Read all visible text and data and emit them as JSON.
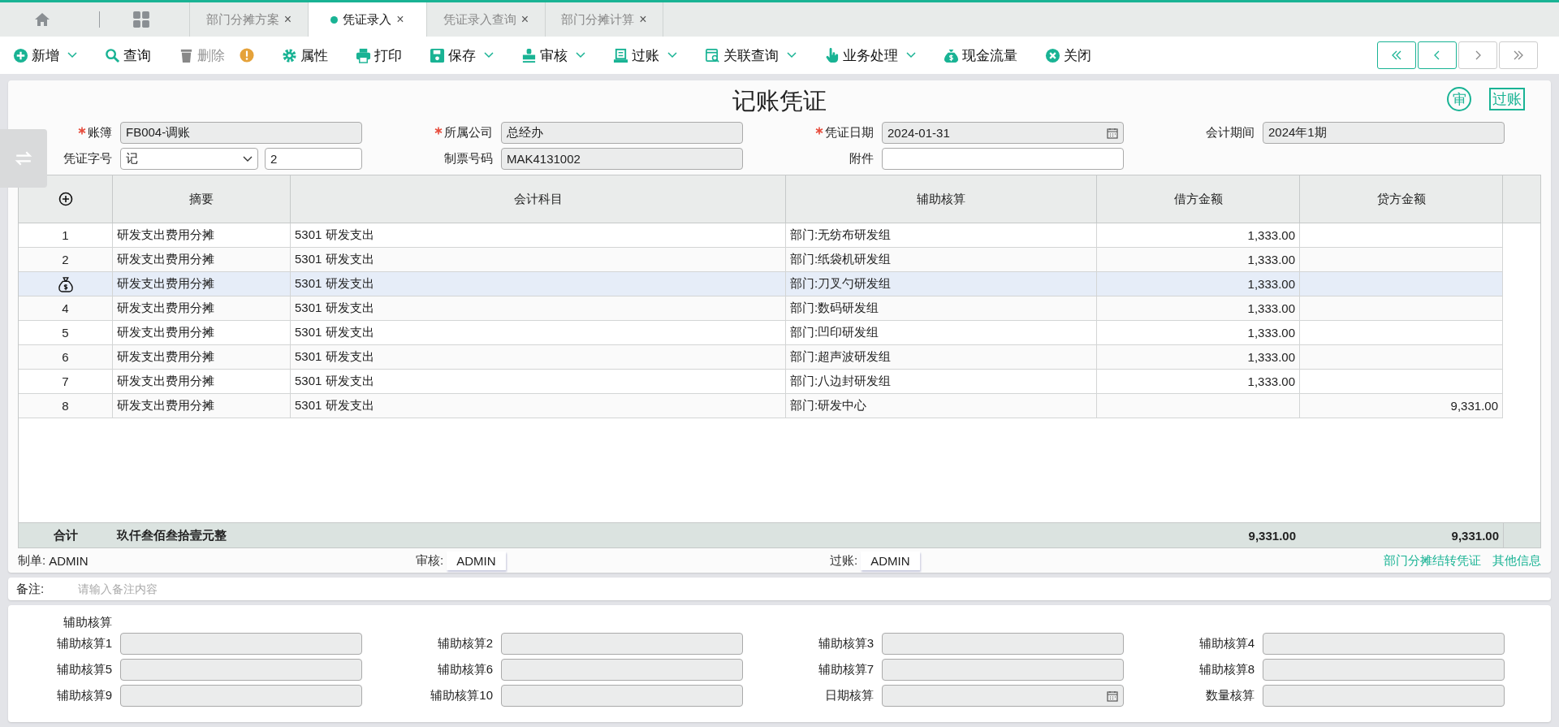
{
  "tabs": [
    {
      "label": "部门分摊方案",
      "selected": false,
      "close": "×"
    },
    {
      "label": "凭证录入",
      "selected": true,
      "close": "×"
    },
    {
      "label": "凭证录入查询",
      "selected": false,
      "close": "×"
    },
    {
      "label": "部门分摊计算",
      "selected": false,
      "close": "×"
    }
  ],
  "toolbar": [
    {
      "label": "新增",
      "kind": "add",
      "dropdown": true,
      "disabled": false
    },
    {
      "label": "查询",
      "kind": "search",
      "dropdown": false,
      "disabled": false
    },
    {
      "label": "删除",
      "kind": "delete",
      "dropdown": false,
      "disabled": true
    },
    {
      "label": "属性",
      "kind": "gear",
      "dropdown": false,
      "disabled": false
    },
    {
      "label": "打印",
      "kind": "print",
      "dropdown": false,
      "disabled": false
    },
    {
      "label": "保存",
      "kind": "save",
      "dropdown": true,
      "disabled": false
    },
    {
      "label": "审核",
      "kind": "stamp",
      "dropdown": true,
      "disabled": false
    },
    {
      "label": "过账",
      "kind": "post",
      "dropdown": true,
      "disabled": false
    },
    {
      "label": "关联查询",
      "kind": "link",
      "dropdown": true,
      "disabled": false
    },
    {
      "label": "业务处理",
      "kind": "hand",
      "dropdown": true,
      "disabled": false
    },
    {
      "label": "现金流量",
      "kind": "money",
      "dropdown": false,
      "disabled": false
    },
    {
      "label": "关闭",
      "kind": "close",
      "dropdown": false,
      "disabled": false
    }
  ],
  "pager": [
    {
      "kind": "first",
      "disabled": false
    },
    {
      "kind": "prev",
      "disabled": false
    },
    {
      "kind": "next",
      "disabled": true
    },
    {
      "kind": "last",
      "disabled": true
    }
  ],
  "title": "记账凭证",
  "audit_stamp": "审",
  "post_stamp": "过账",
  "form": [
    {
      "label": "账簿",
      "required": true,
      "kind": "text",
      "readonly": true,
      "value": "FB004-调账"
    },
    {
      "label": "所属公司",
      "required": true,
      "kind": "text",
      "readonly": true,
      "value": "总经办"
    },
    {
      "label": "凭证日期",
      "required": true,
      "kind": "date",
      "readonly": true,
      "value": "2024-01-31"
    },
    {
      "label": "会计期间",
      "required": false,
      "kind": "text",
      "readonly": true,
      "value": "2024年1期"
    },
    {
      "label": "凭证字号",
      "required": false,
      "kind": "select_number",
      "readonly": false,
      "value": "记",
      "number": "2"
    },
    {
      "label": "制票号码",
      "required": false,
      "kind": "text",
      "readonly": true,
      "value": "MAK4131002"
    },
    {
      "label": "附件",
      "required": false,
      "kind": "text",
      "readonly": false
    }
  ],
  "table": {
    "columns": [
      "摘要",
      "会计科目",
      "辅助核算",
      "借方金额",
      "贷方金额"
    ],
    "rows": [
      {
        "kind": "number",
        "no": "1",
        "summary": "研发支出费用分摊",
        "account": "5301 研发支出",
        "aux": "部门:无纺布研发组",
        "debit": "1,333.00",
        "credit": "",
        "selected": false
      },
      {
        "kind": "number",
        "no": "2",
        "summary": "研发支出费用分摊",
        "account": "5301 研发支出",
        "aux": "部门:纸袋机研发组",
        "debit": "1,333.00",
        "credit": "",
        "selected": false
      },
      {
        "kind": "cash",
        "summary": "研发支出费用分摊",
        "account": "5301 研发支出",
        "aux": "部门:刀叉勺研发组",
        "debit": "1,333.00",
        "credit": "",
        "selected": true
      },
      {
        "kind": "number",
        "no": "4",
        "summary": "研发支出费用分摊",
        "account": "5301 研发支出",
        "aux": "部门:数码研发组",
        "debit": "1,333.00",
        "credit": "",
        "selected": false
      },
      {
        "kind": "number",
        "no": "5",
        "summary": "研发支出费用分摊",
        "account": "5301 研发支出",
        "aux": "部门:凹印研发组",
        "debit": "1,333.00",
        "credit": "",
        "selected": false
      },
      {
        "kind": "number",
        "no": "6",
        "summary": "研发支出费用分摊",
        "account": "5301 研发支出",
        "aux": "部门:超声波研发组",
        "debit": "1,333.00",
        "credit": "",
        "selected": false
      },
      {
        "kind": "number",
        "no": "7",
        "summary": "研发支出费用分摊",
        "account": "5301 研发支出",
        "aux": "部门:八边封研发组",
        "debit": "1,333.00",
        "credit": "",
        "selected": false
      },
      {
        "kind": "number",
        "no": "8",
        "summary": "研发支出费用分摊",
        "account": "5301 研发支出",
        "aux": "部门:研发中心",
        "debit": "",
        "credit": "9,331.00",
        "selected": false
      }
    ],
    "total": {
      "label": "合计",
      "words": "玖仟叁佰叁拾壹元整",
      "debit": "9,331.00",
      "credit": "9,331.00"
    }
  },
  "signatures": [
    {
      "label": "制单:",
      "value": "ADMIN",
      "boxed": false
    },
    {
      "label": "审核:",
      "value": "ADMIN",
      "boxed": true
    },
    {
      "label": "过账:",
      "value": "ADMIN",
      "boxed": true
    }
  ],
  "links": [
    "部门分摊结转凭证",
    "其他信息"
  ],
  "remark": {
    "label": "备注:",
    "placeholder": "请输入备注内容"
  },
  "aux": {
    "title": "辅助核算",
    "fields": [
      {
        "label": "辅助核算1",
        "kind": "text"
      },
      {
        "label": "辅助核算2",
        "kind": "text"
      },
      {
        "label": "辅助核算3",
        "kind": "text"
      },
      {
        "label": "辅助核算4",
        "kind": "text"
      },
      {
        "label": "辅助核算5",
        "kind": "text"
      },
      {
        "label": "辅助核算6",
        "kind": "text"
      },
      {
        "label": "辅助核算7",
        "kind": "text"
      },
      {
        "label": "辅助核算8",
        "kind": "text"
      },
      {
        "label": "辅助核算9",
        "kind": "text"
      },
      {
        "label": "辅助核算10",
        "kind": "text"
      },
      {
        "label": "日期核算",
        "kind": "date"
      },
      {
        "label": "数量核算",
        "kind": "text"
      }
    ]
  }
}
